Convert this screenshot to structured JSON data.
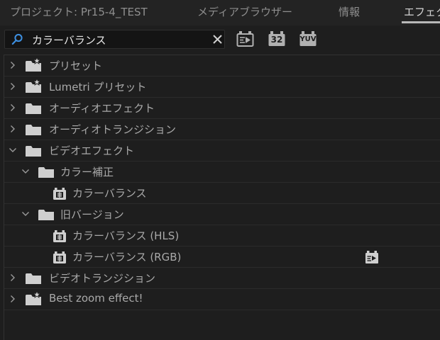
{
  "tabs": [
    {
      "label": "プロジェクト: Pr15-4_TEST",
      "active": false
    },
    {
      "label": "メディアブラウザー",
      "active": false
    },
    {
      "label": "情報",
      "active": false
    },
    {
      "label": "エフェクト",
      "active": true
    }
  ],
  "search": {
    "value": "カラーバランス",
    "placeholder": ""
  },
  "toolbar": {
    "accelerated_icon": "accelerated-effects-icon",
    "bit32_label": "32",
    "yuv_label": "YUV"
  },
  "tree": {
    "items": [
      {
        "label": "プリセット",
        "icon": "starred-folder-icon",
        "expanded": false
      },
      {
        "label": "Lumetri プリセット",
        "icon": "starred-folder-icon",
        "expanded": false
      },
      {
        "label": "オーディオエフェクト",
        "icon": "folder-icon",
        "expanded": false
      },
      {
        "label": "オーディオトランジション",
        "icon": "folder-icon",
        "expanded": false
      },
      {
        "label": "ビデオエフェクト",
        "icon": "folder-icon",
        "expanded": true
      },
      {
        "label": "カラー補正",
        "icon": "folder-icon",
        "expanded": true
      },
      {
        "label": "カラーバランス",
        "icon": "effect-icon"
      },
      {
        "label": "旧バージョン",
        "icon": "folder-icon",
        "expanded": true
      },
      {
        "label": "カラーバランス (HLS)",
        "icon": "effect-icon"
      },
      {
        "label": "カラーバランス (RGB)",
        "icon": "effect-icon",
        "badge": "accelerated-effects-icon"
      },
      {
        "label": "ビデオトランジション",
        "icon": "folder-icon",
        "expanded": false
      },
      {
        "label": "Best zoom effect!",
        "icon": "starred-folder-icon",
        "expanded": false
      }
    ]
  },
  "colors": {
    "background": "#1e1e1e",
    "text": "#a9a9a9",
    "active_tab": "#d4d4d4",
    "search_bg": "#141414"
  }
}
